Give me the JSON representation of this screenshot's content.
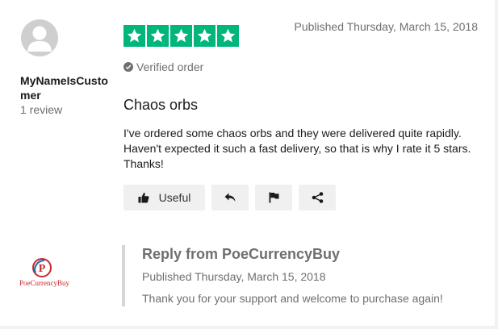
{
  "user": {
    "name": "MyNameIsCustomer",
    "review_count": "1 review",
    "avatar_icon": "user-silhouette-icon"
  },
  "review": {
    "rating": 5,
    "rating_max": 5,
    "star_color": "#00b67a",
    "published": "Published Thursday, March 15, 2018",
    "verified_label": "Verified order",
    "title": "Chaos orbs",
    "body": "I've ordered some chaos orbs and they were delivered quite rapidly. Haven't expected it such a fast delivery, so that is why I rate it 5 stars. Thanks!"
  },
  "actions": {
    "useful_label": "Useful",
    "useful_icon": "thumbs-up-icon",
    "reply_icon": "reply-arrow-icon",
    "flag_icon": "flag-icon",
    "share_icon": "share-icon"
  },
  "company_reply": {
    "title": "Reply from PoeCurrencyBuy",
    "published": "Published Thursday, March 15, 2018",
    "text": "Thank you for your support and welcome to purchase again!",
    "logo_text": "PoeCurrencyBuy",
    "logo_color": "#c6292f"
  }
}
